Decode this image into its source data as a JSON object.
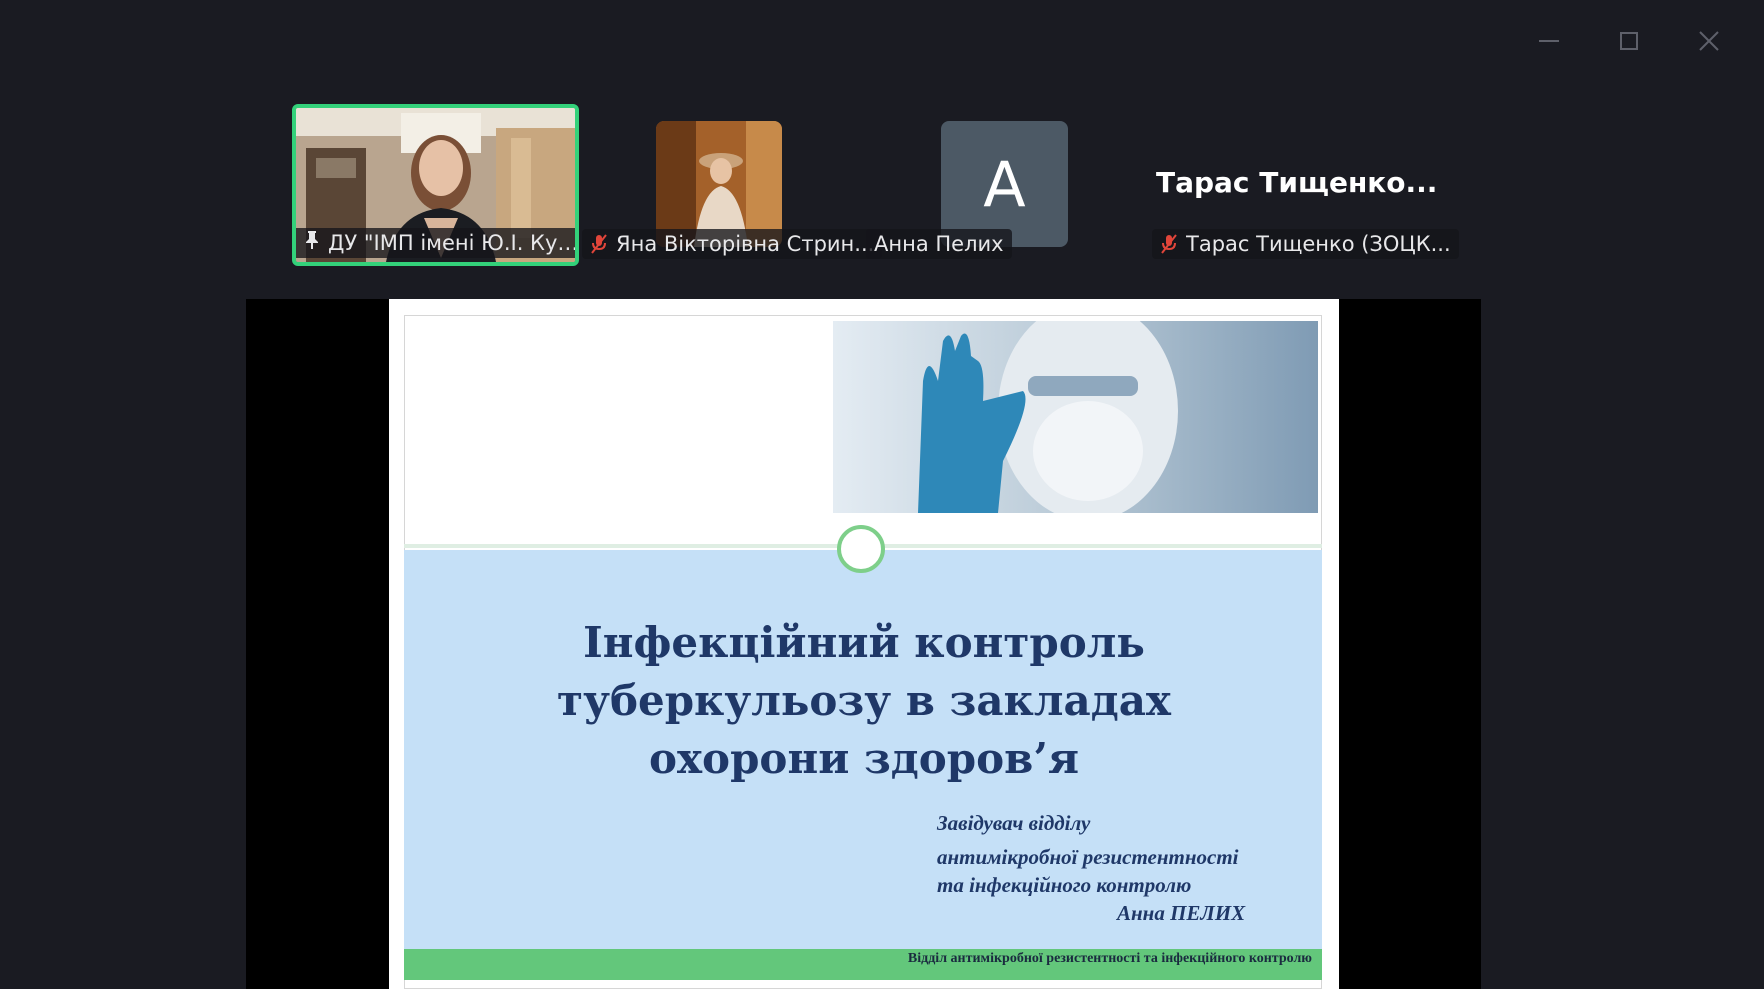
{
  "window": {
    "minimize_icon": "minimize-icon",
    "maximize_icon": "maximize-icon",
    "close_icon": "close-icon"
  },
  "participants": [
    {
      "name": "ДУ \"ІМП імені Ю.І. Кун...",
      "pinned": true,
      "muted": false,
      "active_speaker": true
    },
    {
      "name": "Яна Вікторівна Стрин...",
      "muted": true
    },
    {
      "name": "Анна Пелих",
      "avatar_letter": "A",
      "muted": false
    },
    {
      "name": "Тарас Тищенко (ЗОЦК...",
      "display_name": "Тарас  Тищенко...",
      "muted": true
    }
  ],
  "slide": {
    "title_line1": "Інфекційний контроль",
    "title_line2": "туберкульозу в закладах",
    "title_line3": "охорони здоров’я",
    "author_line1": "Завідувач відділу",
    "author_line2": "антимікробної резистентності",
    "author_line3": "та інфекційного контролю",
    "author_line4": "Анна ПЕЛИХ",
    "footer": "Відділ антимікробної резистентності та інфекційного контролю"
  },
  "colors": {
    "active_border": "#33d17a",
    "title": "#1f3868",
    "band": "#c5e0f7",
    "footer_bar": "#63c77b",
    "muted_icon": "#e0453a"
  }
}
